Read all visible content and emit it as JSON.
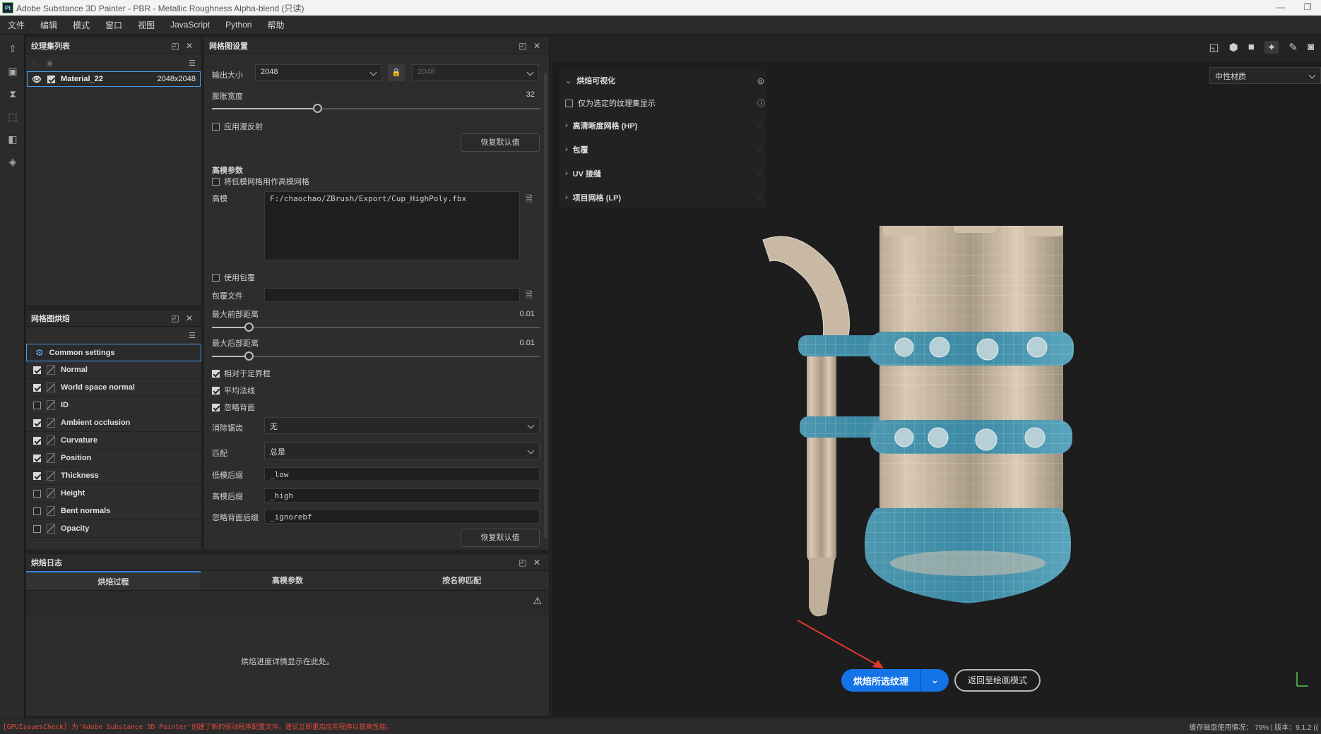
{
  "window": {
    "title": "Adobe Substance 3D Painter - PBR - Metallic Roughness Alpha-blend (只读)",
    "logo": "Pt",
    "min": "—",
    "restore": "❐"
  },
  "menu": [
    "文件",
    "编辑",
    "模式",
    "窗口",
    "视图",
    "JavaScript",
    "Python",
    "帮助"
  ],
  "texture_set_list": {
    "title": "纹理集列表",
    "material": {
      "name": "Material_22",
      "resolution": "2048x2048"
    }
  },
  "mesh_map_list": {
    "title": "网格图烘焙",
    "common": "Common settings",
    "items": [
      {
        "label": "Normal",
        "checked": true
      },
      {
        "label": "World space normal",
        "checked": true
      },
      {
        "label": "ID",
        "checked": false
      },
      {
        "label": "Ambient occlusion",
        "checked": true
      },
      {
        "label": "Curvature",
        "checked": true
      },
      {
        "label": "Position",
        "checked": true
      },
      {
        "label": "Thickness",
        "checked": true
      },
      {
        "label": "Height",
        "checked": false
      },
      {
        "label": "Bent normals",
        "checked": false
      },
      {
        "label": "Opacity",
        "checked": false
      }
    ]
  },
  "settings": {
    "title": "网格图设置",
    "output_size_label": "输出大小",
    "output_size": "2048",
    "output_size_2": "2048",
    "dilation_label": "膨胀宽度",
    "dilation_value": "32",
    "dilation_fraction": 0.32,
    "apply_diffusion": "应用漫反射",
    "reset": "恢复默认值",
    "hp_section": "高模参数",
    "use_lp_as_hp": "将低模网格用作高模网格",
    "hp_label": "高模",
    "hp_path": "F:/chaochao/ZBrush/Export/Cup_HighPoly.fbx",
    "use_cage": "使用包覆",
    "cage_file": "包覆文件",
    "max_front_label": "最大前部距离",
    "max_front_value": "0.01",
    "max_rear_label": "最大后部距离",
    "max_rear_value": "0.01",
    "relative_bbox": "相对于定界框",
    "average_normals": "平均法线",
    "ignore_backface": "忽略背面",
    "antialias_label": "消除锯齿",
    "antialias_value": "无",
    "match_label": "匹配",
    "match_value": "总是",
    "low_suffix_label": "低模后缀",
    "low_suffix": "_low",
    "high_suffix_label": "高模后缀",
    "high_suffix": "_high",
    "ignore_suffix_label": "忽略背面后缀",
    "ignore_suffix": "_ignorebf",
    "reset2": "恢复默认值"
  },
  "bake_log": {
    "title": "烘焙日志",
    "tabs": [
      "烘焙过程",
      "高模参数",
      "按名称匹配"
    ],
    "placeholder": "烘焙进度详情显示在此处。"
  },
  "bake_vis": {
    "title": "烘焙可视化",
    "only_selected": "仅为选定的纹理集显示",
    "rows": [
      "高清晰度网格 (HP)",
      "包覆",
      "UV 接缝",
      "项目网格 (LP)"
    ]
  },
  "viewport": {
    "material_select": "中性材质",
    "bake_button": "烘焙所选纹理",
    "return_button": "返回至绘画模式"
  },
  "status": {
    "error": "[GPUIssuesCheck] 为'Adobe Substance 3D Painter'创建了新的驱动程序配置文件。建议立即重启应用程序以提高性能。",
    "right": "缓存磁盘使用情况：  79%  | 版本：9.1.2 (("
  },
  "colors": {
    "accent": "#1473e6",
    "selection": "#4a9af0",
    "error": "#e24a3d",
    "mug_blue": "#4d9db5",
    "mug_cream": "#d8c8b0"
  }
}
